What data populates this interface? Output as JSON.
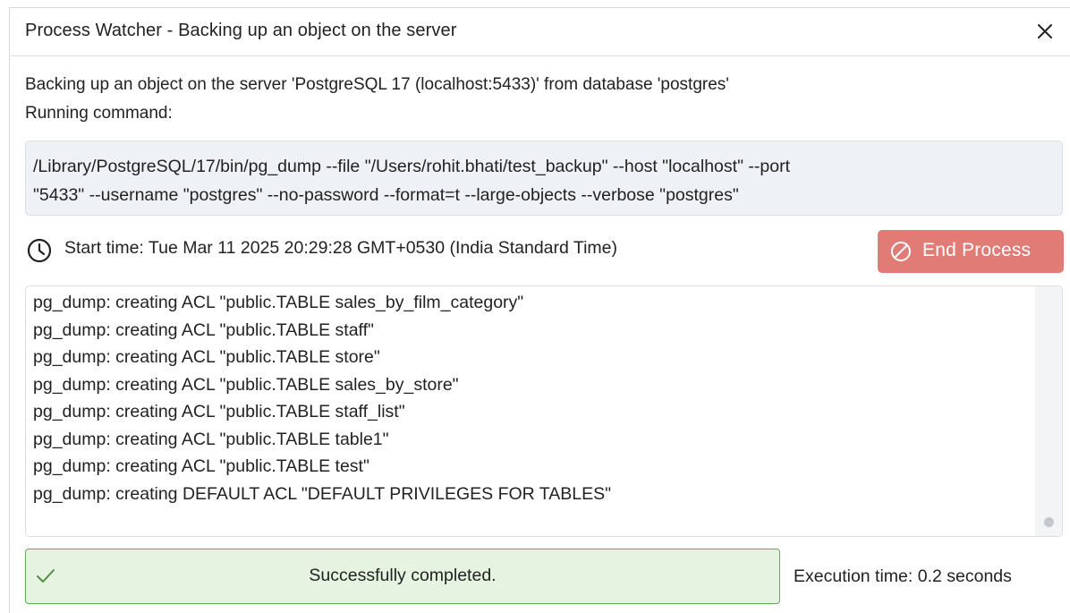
{
  "dialog": {
    "title": "Process Watcher - Backing up an object on the server",
    "description_line1": "Backing up an object on the server 'PostgreSQL 17 (localhost:5433)' from database 'postgres'",
    "description_line2": "Running command:",
    "command_line1": "/Library/PostgreSQL/17/bin/pg_dump --file \"/Users/rohit.bhati/test_backup\" --host \"localhost\" --port",
    "command_line2": "\"5433\" --username \"postgres\" --no-password --format=t --large-objects --verbose \"postgres\"",
    "start_time": "Start time: Tue Mar 11 2025 20:29:28 GMT+0530 (India Standard Time)",
    "end_button_label": "End Process",
    "log_lines": [
      "pg_dump: creating ACL \"public.TABLE sales_by_film_category\"",
      "pg_dump: creating ACL \"public.TABLE staff\"",
      "pg_dump: creating ACL \"public.TABLE store\"",
      "pg_dump: creating ACL \"public.TABLE sales_by_store\"",
      "pg_dump: creating ACL \"public.TABLE staff_list\"",
      "pg_dump: creating ACL \"public.TABLE table1\"",
      "pg_dump: creating ACL \"public.TABLE test\"",
      "pg_dump: creating DEFAULT ACL \"DEFAULT PRIVILEGES FOR TABLES\""
    ],
    "status_text": "Successfully completed.",
    "execution_time": "Execution time: 0.2 seconds"
  },
  "icons": {
    "close": "close-icon",
    "clock": "clock-icon",
    "end": "ban-icon",
    "status": "check-icon"
  },
  "colors": {
    "end_button": "#e07b76",
    "success_bg": "#e6f3e1",
    "success_border": "#6aa65f",
    "command_bg": "#eef1f6"
  }
}
